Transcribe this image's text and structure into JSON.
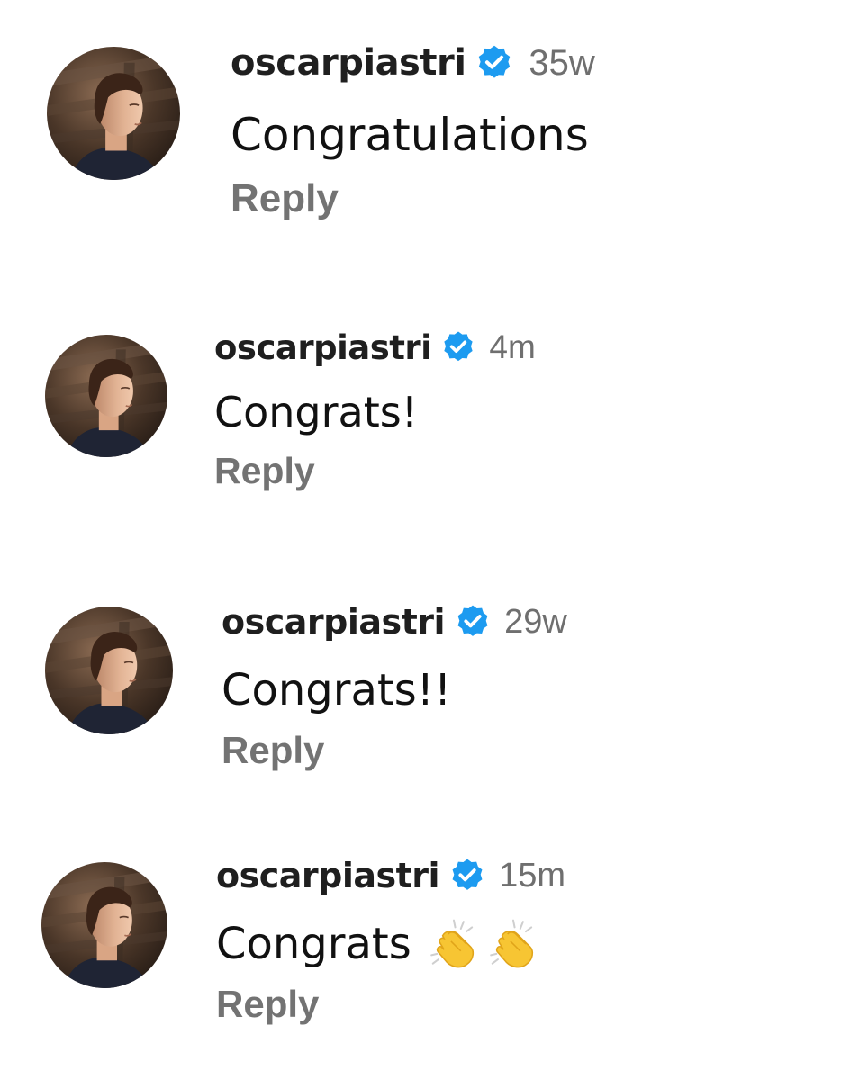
{
  "comments": [
    {
      "username": "oscarpiastri",
      "verified": true,
      "time": "35w",
      "text": "Congratulations",
      "reply_label": "Reply",
      "emojis": []
    },
    {
      "username": "oscarpiastri",
      "verified": true,
      "time": "4m",
      "text": "Congrats!",
      "reply_label": "Reply",
      "emojis": []
    },
    {
      "username": "oscarpiastri",
      "verified": true,
      "time": "29w",
      "text": "Congrats!!",
      "reply_label": "Reply",
      "emojis": []
    },
    {
      "username": "oscarpiastri",
      "verified": true,
      "time": "15m",
      "text": "Congrats",
      "reply_label": "Reply",
      "emojis": [
        "clapping-hands-emoji",
        "clapping-hands-emoji"
      ]
    }
  ],
  "colors": {
    "verified_badge": "#1d9bf0",
    "username": "#1f1f1f",
    "timestamp": "#6f6f6f",
    "reply": "#737373",
    "comment_text": "#111111"
  },
  "icons": {
    "verified": "verified-badge-icon",
    "avatar": "profile-photo-avatar"
  }
}
